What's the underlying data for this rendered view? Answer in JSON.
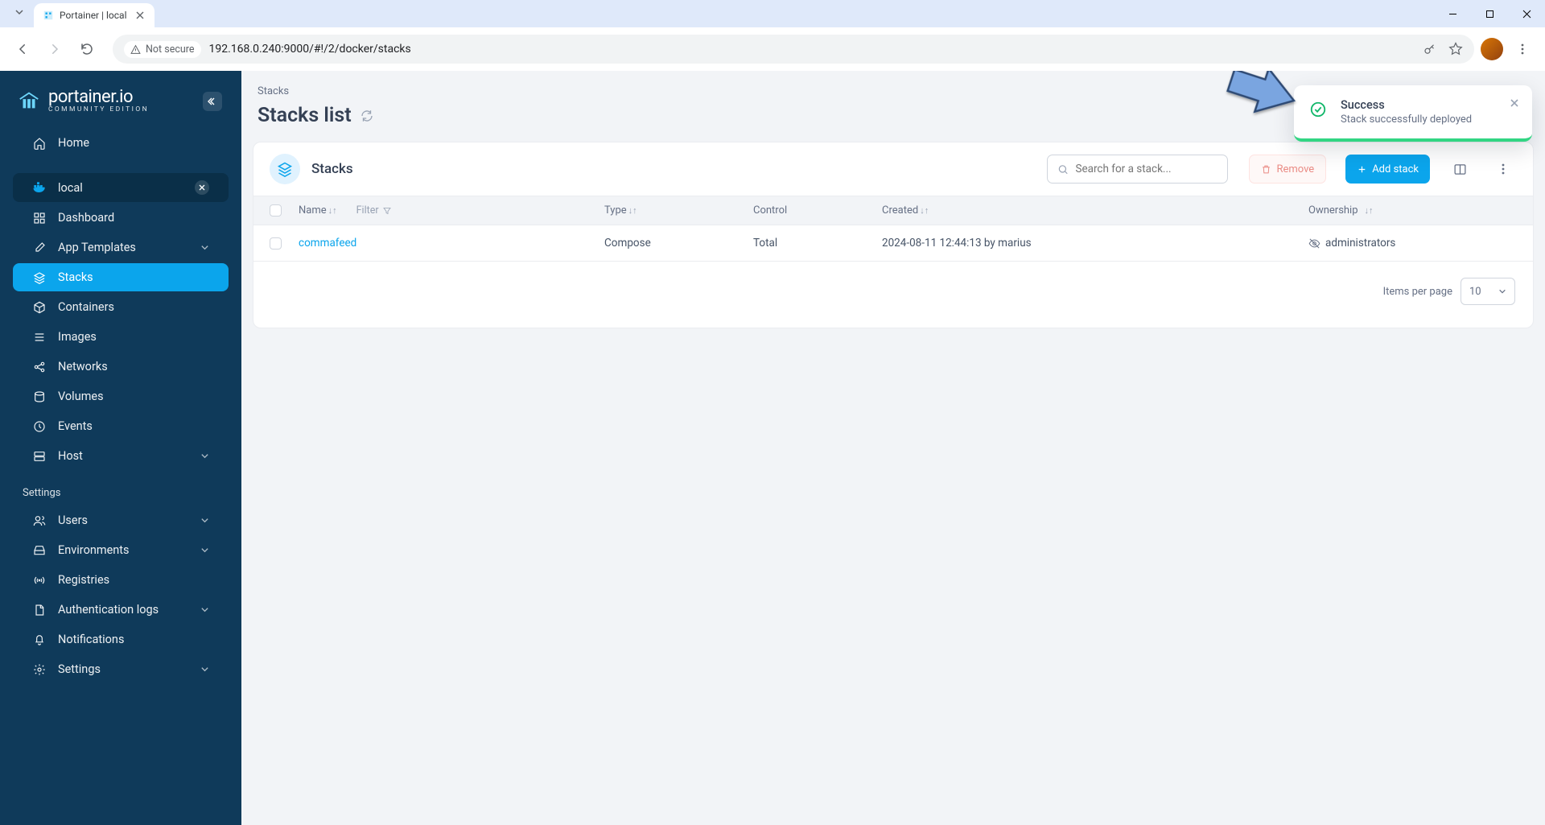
{
  "browser": {
    "tab_title": "Portainer | local",
    "not_secure_label": "Not secure",
    "url": "192.168.0.240:9000/#!/2/docker/stacks"
  },
  "sidebar": {
    "logo_text": "portainer.io",
    "logo_sub": "COMMUNITY EDITION",
    "home_label": "Home",
    "env_label": "local",
    "items": [
      {
        "label": "Dashboard"
      },
      {
        "label": "App Templates"
      },
      {
        "label": "Stacks"
      },
      {
        "label": "Containers"
      },
      {
        "label": "Images"
      },
      {
        "label": "Networks"
      },
      {
        "label": "Volumes"
      },
      {
        "label": "Events"
      },
      {
        "label": "Host"
      }
    ],
    "settings_title": "Settings",
    "settings_items": [
      {
        "label": "Users"
      },
      {
        "label": "Environments"
      },
      {
        "label": "Registries"
      },
      {
        "label": "Authentication logs"
      },
      {
        "label": "Notifications"
      },
      {
        "label": "Settings"
      }
    ]
  },
  "page": {
    "breadcrumb": "Stacks",
    "title": "Stacks list"
  },
  "panel": {
    "title": "Stacks",
    "search_placeholder": "Search for a stack...",
    "remove_label": "Remove",
    "add_label": "Add stack",
    "columns": {
      "name": "Name",
      "filter": "Filter",
      "type": "Type",
      "control": "Control",
      "created": "Created",
      "ownership": "Ownership"
    },
    "rows": [
      {
        "name": "commafeed",
        "type": "Compose",
        "control": "Total",
        "created": "2024-08-11 12:44:13 by marius",
        "ownership": "administrators"
      }
    ],
    "footer_label": "Items per page",
    "per_page": "10"
  },
  "toast": {
    "title": "Success",
    "message": "Stack successfully deployed"
  }
}
